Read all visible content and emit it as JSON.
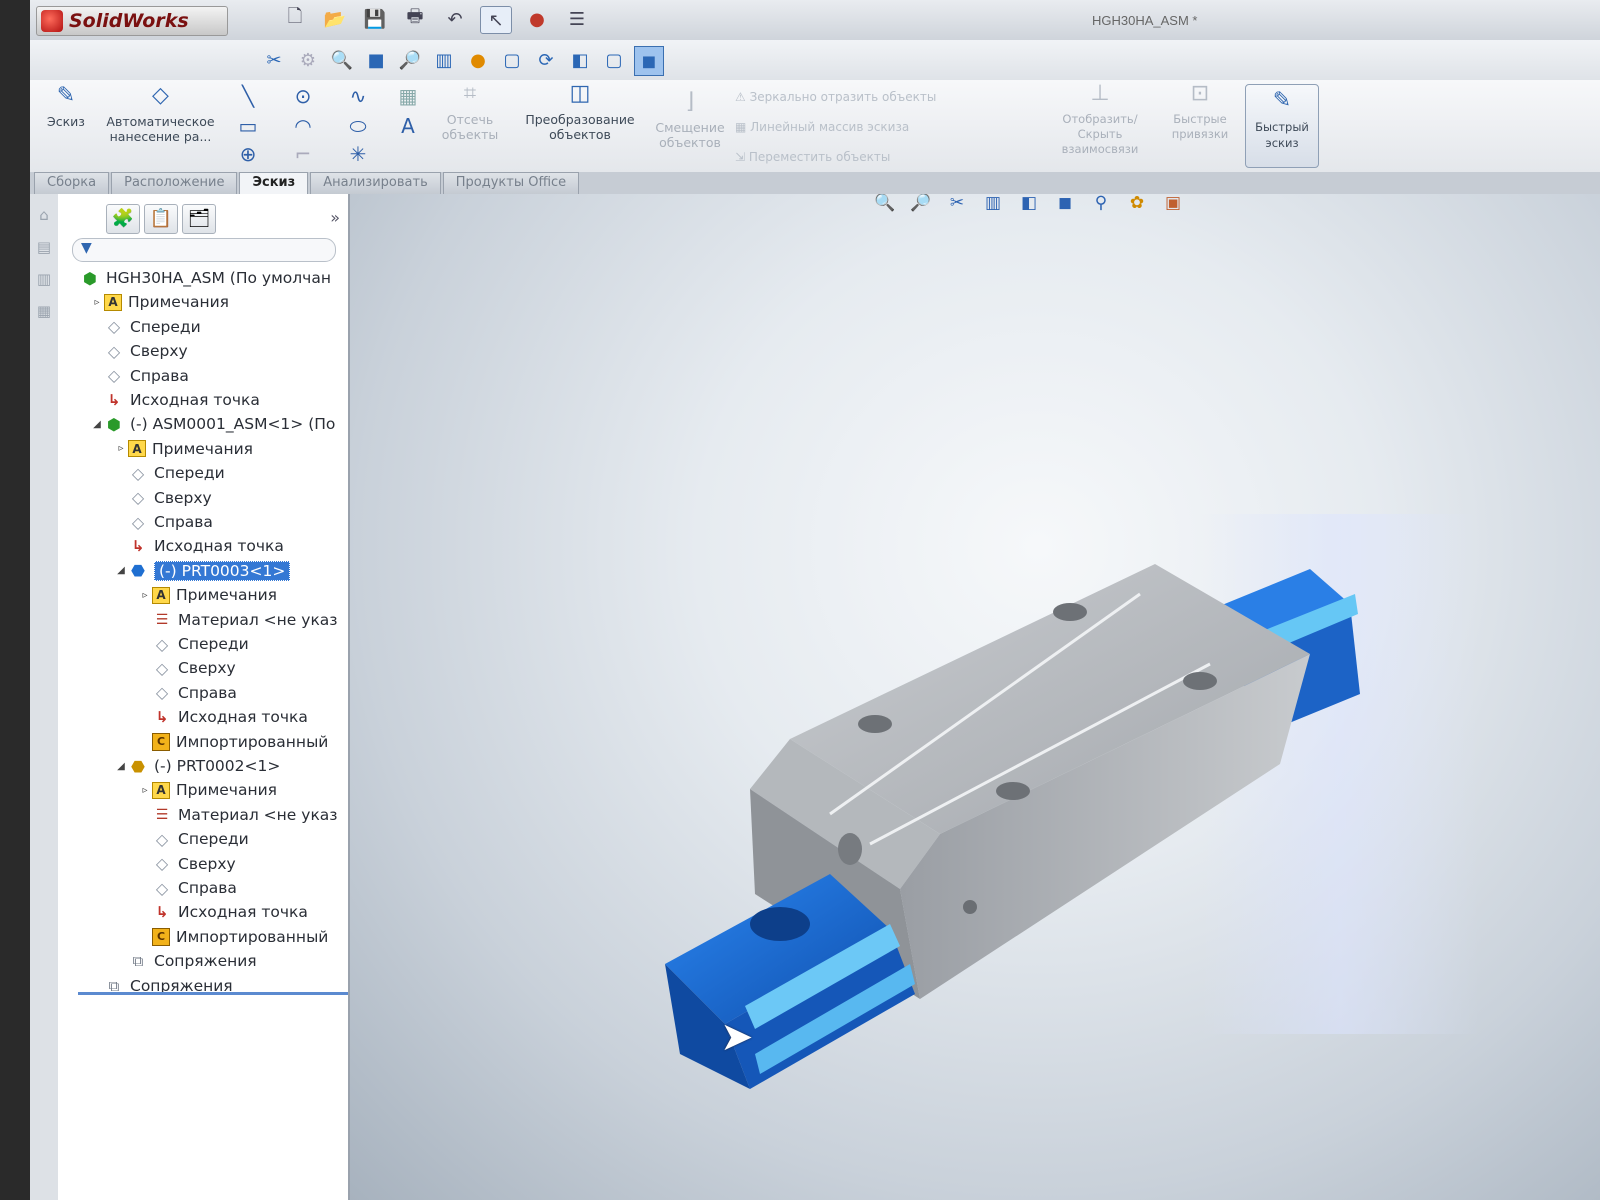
{
  "app": {
    "logo_text": "SolidWorks",
    "document_title": "HGH30HA_ASM *"
  },
  "ribbon": {
    "sketch": "Эскиз",
    "auto_dimension": "Автоматическое нанесение ра...",
    "trim": "Отсечь объекты",
    "convert": "Преобразование объектов",
    "offset": "Смещение объектов",
    "mirror": "Зеркально отразить объекты",
    "linear_pattern": "Линейный массив эскиза",
    "move_entities": "Переместить объекты",
    "show_hide_relations": "Отобразить/Скрыть взаимосвязи",
    "quick_snaps": "Быстрые привязки",
    "rapid_sketch": "Быстрый эскиз"
  },
  "tabs": [
    {
      "label": "Сборка",
      "active": false
    },
    {
      "label": "Расположение",
      "active": false
    },
    {
      "label": "Эскиз",
      "active": true
    },
    {
      "label": "Анализировать",
      "active": false
    },
    {
      "label": "Продукты Office",
      "active": false
    }
  ],
  "tree": [
    {
      "label": "HGH30HA_ASM  (По умолчан",
      "icon": "assembly-icon",
      "indent": 0,
      "arrow": ""
    },
    {
      "label": "Примечания",
      "icon": "annotations-icon",
      "indent": 1,
      "arrow": "▹"
    },
    {
      "label": "Спереди",
      "icon": "plane-icon",
      "indent": 1,
      "arrow": ""
    },
    {
      "label": "Сверху",
      "icon": "plane-icon",
      "indent": 1,
      "arrow": ""
    },
    {
      "label": "Справа",
      "icon": "plane-icon",
      "indent": 1,
      "arrow": ""
    },
    {
      "label": "Исходная точка",
      "icon": "origin-icon",
      "indent": 1,
      "arrow": ""
    },
    {
      "label": "(-) ASM0001_ASM<1> (По",
      "icon": "assembly-icon",
      "indent": 1,
      "arrow": "◢"
    },
    {
      "label": "Примечания",
      "icon": "annotations-icon",
      "indent": 2,
      "arrow": "▹"
    },
    {
      "label": "Спереди",
      "icon": "plane-icon",
      "indent": 2,
      "arrow": ""
    },
    {
      "label": "Сверху",
      "icon": "plane-icon",
      "indent": 2,
      "arrow": ""
    },
    {
      "label": "Справа",
      "icon": "plane-icon",
      "indent": 2,
      "arrow": ""
    },
    {
      "label": "Исходная точка",
      "icon": "origin-icon",
      "indent": 2,
      "arrow": ""
    },
    {
      "label": "(-) PRT0003<1>",
      "icon": "part-icon",
      "indent": 2,
      "arrow": "◢",
      "selected": true
    },
    {
      "label": "Примечания",
      "icon": "annotations-icon",
      "indent": 3,
      "arrow": "▹"
    },
    {
      "label": "Материал <не указ",
      "icon": "material-icon",
      "indent": 3,
      "arrow": ""
    },
    {
      "label": "Спереди",
      "icon": "plane-icon",
      "indent": 3,
      "arrow": ""
    },
    {
      "label": "Сверху",
      "icon": "plane-icon",
      "indent": 3,
      "arrow": ""
    },
    {
      "label": "Справа",
      "icon": "plane-icon",
      "indent": 3,
      "arrow": ""
    },
    {
      "label": "Исходная точка",
      "icon": "origin-icon",
      "indent": 3,
      "arrow": ""
    },
    {
      "label": "Импортированный",
      "icon": "imported-icon",
      "indent": 3,
      "arrow": ""
    },
    {
      "label": "(-) PRT0002<1>",
      "icon": "part-icon-2",
      "indent": 2,
      "arrow": "◢"
    },
    {
      "label": "Примечания",
      "icon": "annotations-icon",
      "indent": 3,
      "arrow": "▹"
    },
    {
      "label": "Материал <не указ",
      "icon": "material-icon",
      "indent": 3,
      "arrow": ""
    },
    {
      "label": "Спереди",
      "icon": "plane-icon",
      "indent": 3,
      "arrow": ""
    },
    {
      "label": "Сверху",
      "icon": "plane-icon",
      "indent": 3,
      "arrow": ""
    },
    {
      "label": "Справа",
      "icon": "plane-icon",
      "indent": 3,
      "arrow": ""
    },
    {
      "label": "Исходная точка",
      "icon": "origin-icon",
      "indent": 3,
      "arrow": ""
    },
    {
      "label": "Импортированный",
      "icon": "imported-icon",
      "indent": 3,
      "arrow": ""
    },
    {
      "label": "Сопряжения",
      "icon": "mates-icon",
      "indent": 2,
      "arrow": ""
    },
    {
      "label": "Сопряжения",
      "icon": "mates-icon",
      "indent": 1,
      "arrow": ""
    }
  ],
  "colors": {
    "selection": "#3478d4",
    "rail_blue": "#1d6fd6",
    "carriage_gray": "#a8acb1"
  }
}
